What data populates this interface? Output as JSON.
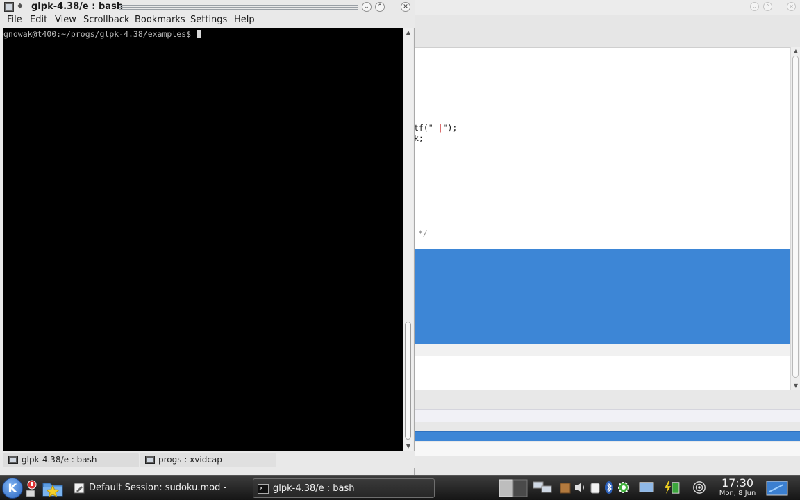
{
  "konsole": {
    "title": "glpk-4.38/e : bash",
    "menu": [
      "File",
      "Edit",
      "View",
      "Scrollback",
      "Bookmarks",
      "Settings",
      "Help"
    ],
    "prompt": "gnowak@t400:~/progs/glpk-4.38/examples$",
    "tabs": [
      {
        "label": "glpk-4.38/e : bash"
      },
      {
        "label": "progs : xvidcap"
      }
    ]
  },
  "kate": {
    "code_line1_pre": "tf(\"",
    "code_line1_str": " |",
    "code_line1_post": "\");",
    "code_line2": "k;",
    "comment": "*/"
  },
  "taskbar": {
    "tasks": [
      {
        "label": "Default Session: sudoku.mod - Kate"
      },
      {
        "label": "glpk-4.38/e : bash"
      }
    ],
    "clock_time": "17:30",
    "clock_date": "Mon, 8 Jun"
  },
  "window_controls": {
    "minimize": "⌄",
    "maximize": "⌃",
    "close": "✕"
  },
  "kmenu_glyph": "K"
}
